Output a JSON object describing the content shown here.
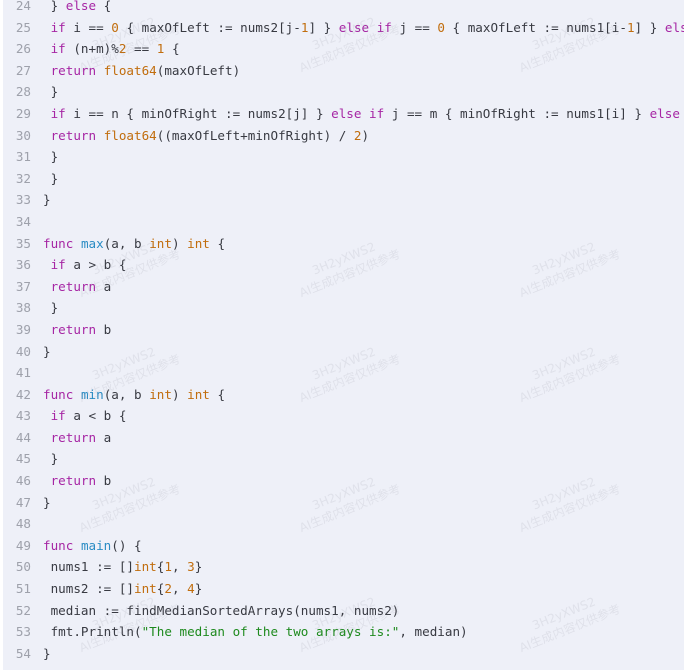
{
  "code": {
    "language": "go",
    "colors": {
      "keyword": "#a626a4",
      "number": "#c16d0d",
      "function": "#2a8cc4",
      "string": "#1e8a1e",
      "text": "#383a42",
      "background": "#eef0f8"
    },
    "lines": [
      {
        "n": "24",
        "tokens": [
          [
            "pl",
            " } "
          ],
          [
            "kw",
            "else"
          ],
          [
            "pl",
            " {"
          ]
        ]
      },
      {
        "n": "25",
        "tokens": [
          [
            "pl",
            " "
          ],
          [
            "kw",
            "if"
          ],
          [
            "pl",
            " i == "
          ],
          [
            "num",
            "0"
          ],
          [
            "pl",
            " { maxOfLeft := nums2[j-"
          ],
          [
            "num",
            "1"
          ],
          [
            "pl",
            "] } "
          ],
          [
            "kw",
            "else if"
          ],
          [
            "pl",
            " j == "
          ],
          [
            "num",
            "0"
          ],
          [
            "pl",
            " { maxOfLeft := nums1[i-"
          ],
          [
            "num",
            "1"
          ],
          [
            "pl",
            "] } "
          ],
          [
            "kw",
            "els"
          ]
        ]
      },
      {
        "n": "26",
        "tokens": [
          [
            "pl",
            " "
          ],
          [
            "kw",
            "if"
          ],
          [
            "pl",
            " (n+m)%"
          ],
          [
            "num",
            "2"
          ],
          [
            "pl",
            " == "
          ],
          [
            "num",
            "1"
          ],
          [
            "pl",
            " {"
          ]
        ]
      },
      {
        "n": "27",
        "tokens": [
          [
            "pl",
            " "
          ],
          [
            "kw",
            "return"
          ],
          [
            "pl",
            " "
          ],
          [
            "ty",
            "float64"
          ],
          [
            "pl",
            "(maxOfLeft)"
          ]
        ]
      },
      {
        "n": "28",
        "tokens": [
          [
            "pl",
            " }"
          ]
        ]
      },
      {
        "n": "29",
        "tokens": [
          [
            "pl",
            " "
          ],
          [
            "kw",
            "if"
          ],
          [
            "pl",
            " i == n { minOfRight := nums2[j] } "
          ],
          [
            "kw",
            "else if"
          ],
          [
            "pl",
            " j == m { minOfRight := nums1[i] } "
          ],
          [
            "kw",
            "else"
          ]
        ]
      },
      {
        "n": "30",
        "tokens": [
          [
            "pl",
            " "
          ],
          [
            "kw",
            "return"
          ],
          [
            "pl",
            " "
          ],
          [
            "ty",
            "float64"
          ],
          [
            "pl",
            "((maxOfLeft+minOfRight) / "
          ],
          [
            "num",
            "2"
          ],
          [
            "pl",
            ")"
          ]
        ]
      },
      {
        "n": "31",
        "tokens": [
          [
            "pl",
            " }"
          ]
        ]
      },
      {
        "n": "32",
        "tokens": [
          [
            "pl",
            " }"
          ]
        ]
      },
      {
        "n": "33",
        "tokens": [
          [
            "pl",
            "}"
          ]
        ]
      },
      {
        "n": "34",
        "tokens": []
      },
      {
        "n": "35",
        "tokens": [
          [
            "kw",
            "func"
          ],
          [
            "pl",
            " "
          ],
          [
            "fn",
            "max"
          ],
          [
            "pl",
            "(a, b "
          ],
          [
            "ty",
            "int"
          ],
          [
            "pl",
            ") "
          ],
          [
            "ty",
            "int"
          ],
          [
            "pl",
            " {"
          ]
        ]
      },
      {
        "n": "36",
        "tokens": [
          [
            "pl",
            " "
          ],
          [
            "kw",
            "if"
          ],
          [
            "pl",
            " a > b {"
          ]
        ]
      },
      {
        "n": "37",
        "tokens": [
          [
            "pl",
            " "
          ],
          [
            "kw",
            "return"
          ],
          [
            "pl",
            " a"
          ]
        ]
      },
      {
        "n": "38",
        "tokens": [
          [
            "pl",
            " }"
          ]
        ]
      },
      {
        "n": "39",
        "tokens": [
          [
            "pl",
            " "
          ],
          [
            "kw",
            "return"
          ],
          [
            "pl",
            " b"
          ]
        ]
      },
      {
        "n": "40",
        "tokens": [
          [
            "pl",
            "}"
          ]
        ]
      },
      {
        "n": "41",
        "tokens": []
      },
      {
        "n": "42",
        "tokens": [
          [
            "kw",
            "func"
          ],
          [
            "pl",
            " "
          ],
          [
            "fn",
            "min"
          ],
          [
            "pl",
            "(a, b "
          ],
          [
            "ty",
            "int"
          ],
          [
            "pl",
            ") "
          ],
          [
            "ty",
            "int"
          ],
          [
            "pl",
            " {"
          ]
        ]
      },
      {
        "n": "43",
        "tokens": [
          [
            "pl",
            " "
          ],
          [
            "kw",
            "if"
          ],
          [
            "pl",
            " a < b {"
          ]
        ]
      },
      {
        "n": "44",
        "tokens": [
          [
            "pl",
            " "
          ],
          [
            "kw",
            "return"
          ],
          [
            "pl",
            " a"
          ]
        ]
      },
      {
        "n": "45",
        "tokens": [
          [
            "pl",
            " }"
          ]
        ]
      },
      {
        "n": "46",
        "tokens": [
          [
            "pl",
            " "
          ],
          [
            "kw",
            "return"
          ],
          [
            "pl",
            " b"
          ]
        ]
      },
      {
        "n": "47",
        "tokens": [
          [
            "pl",
            "}"
          ]
        ]
      },
      {
        "n": "48",
        "tokens": []
      },
      {
        "n": "49",
        "tokens": [
          [
            "kw",
            "func"
          ],
          [
            "pl",
            " "
          ],
          [
            "fn",
            "main"
          ],
          [
            "pl",
            "() {"
          ]
        ]
      },
      {
        "n": "50",
        "tokens": [
          [
            "pl",
            " nums1 := []"
          ],
          [
            "ty",
            "int"
          ],
          [
            "pl",
            "{"
          ],
          [
            "num",
            "1"
          ],
          [
            "pl",
            ", "
          ],
          [
            "num",
            "3"
          ],
          [
            "pl",
            "}"
          ]
        ]
      },
      {
        "n": "51",
        "tokens": [
          [
            "pl",
            " nums2 := []"
          ],
          [
            "ty",
            "int"
          ],
          [
            "pl",
            "{"
          ],
          [
            "num",
            "2"
          ],
          [
            "pl",
            ", "
          ],
          [
            "num",
            "4"
          ],
          [
            "pl",
            "}"
          ]
        ]
      },
      {
        "n": "52",
        "tokens": [
          [
            "pl",
            " median := findMedianSortedArrays(nums1, nums2)"
          ]
        ]
      },
      {
        "n": "53",
        "tokens": [
          [
            "pl",
            " fmt.Println("
          ],
          [
            "str",
            "\"The median of the two arrays is:\""
          ],
          [
            "pl",
            ", median)"
          ]
        ]
      },
      {
        "n": "54",
        "tokens": [
          [
            "pl",
            "}"
          ]
        ]
      }
    ]
  },
  "watermark": {
    "line1": "3H2yXWS2",
    "line2": "AI生成内容仅供参考"
  }
}
